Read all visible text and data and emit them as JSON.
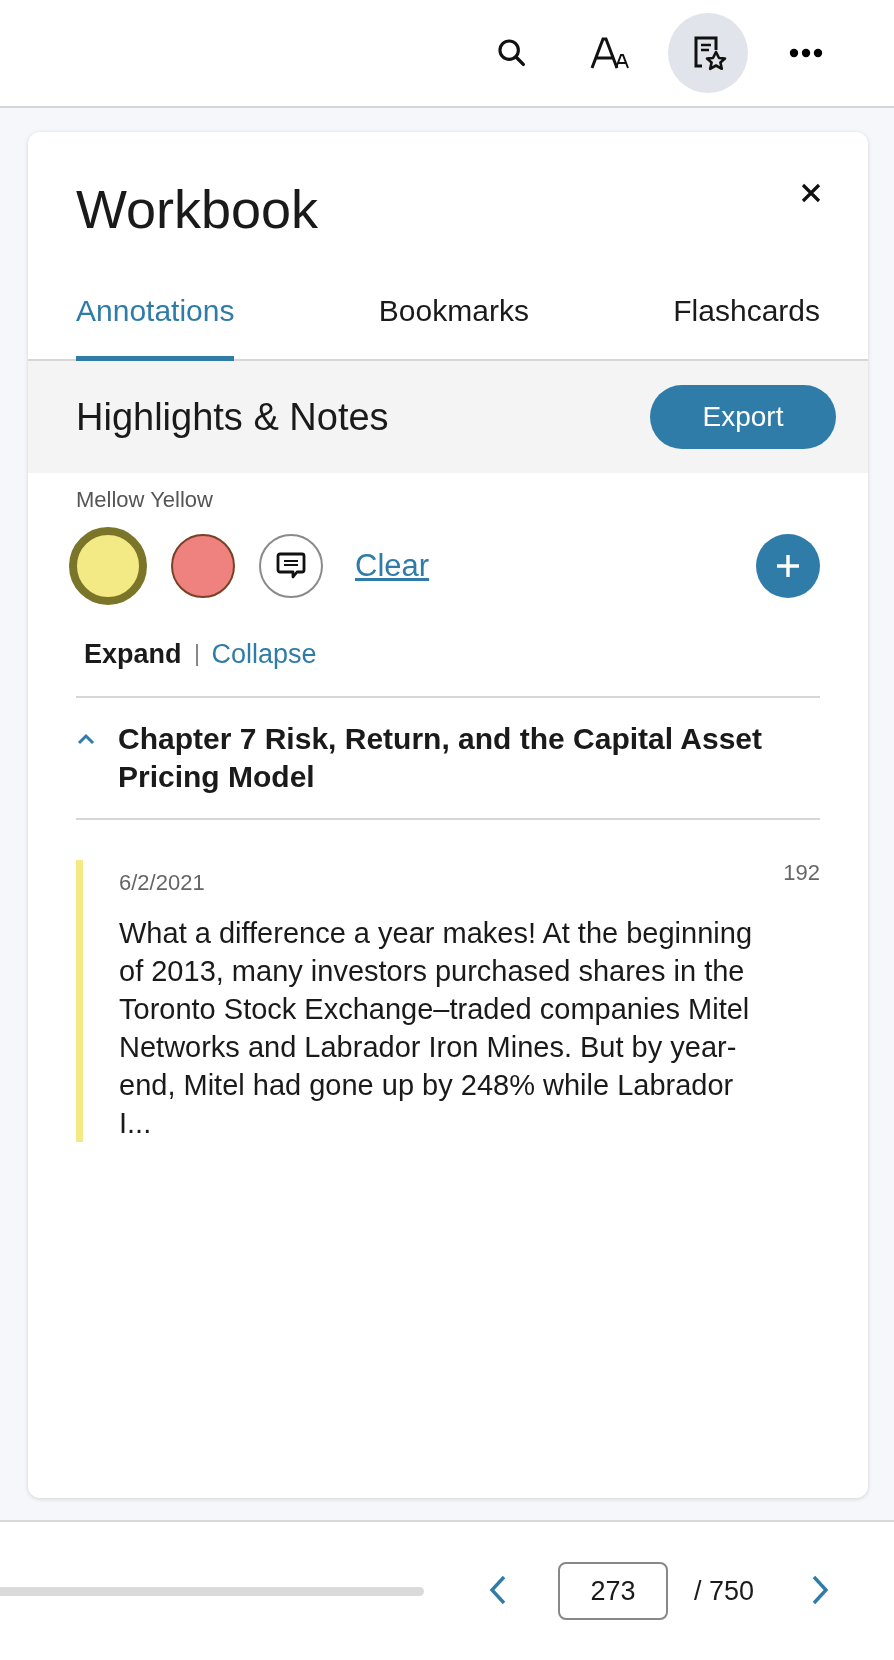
{
  "toolbar": {
    "buttons": [
      {
        "kind": "search",
        "selected": false
      },
      {
        "kind": "font",
        "selected": false
      },
      {
        "kind": "workbook",
        "selected": true
      },
      {
        "kind": "more",
        "selected": false
      }
    ]
  },
  "panel": {
    "title": "Workbook",
    "tabs": [
      {
        "label": "Annotations",
        "selected": true
      },
      {
        "label": "Bookmarks",
        "selected": false
      },
      {
        "label": "Flashcards",
        "selected": false
      }
    ],
    "header": {
      "title": "Highlights & Notes",
      "button": "Export"
    },
    "filter_label": "Mellow Yellow",
    "filters": [
      {
        "kind": "swatch",
        "color": "#f3ea85",
        "selected": true
      },
      {
        "kind": "swatch",
        "color": "#ef827e",
        "selected": false
      },
      {
        "kind": "note",
        "selected": false
      }
    ],
    "clear_link": "Clear",
    "expand": "Expand",
    "collapse": "Collapse",
    "chapters": [
      {
        "title": "Chapter 7 Risk, Return, and the Capital Asset Pricing Model",
        "expanded": true,
        "notes": [
          {
            "date": "6/2/2021",
            "page": "192",
            "color": "#f3ea85",
            "text": "What a difference a year makes! At the beginning of 2013, many investors purchased shares in the Toronto Stock Exchange–traded companies Mitel Networks and Labrador Iron Mines. But by year-end, Mitel had gone up by 248% while Labrador I..."
          }
        ]
      }
    ]
  },
  "footer": {
    "page": "273",
    "total": "/ 750"
  }
}
